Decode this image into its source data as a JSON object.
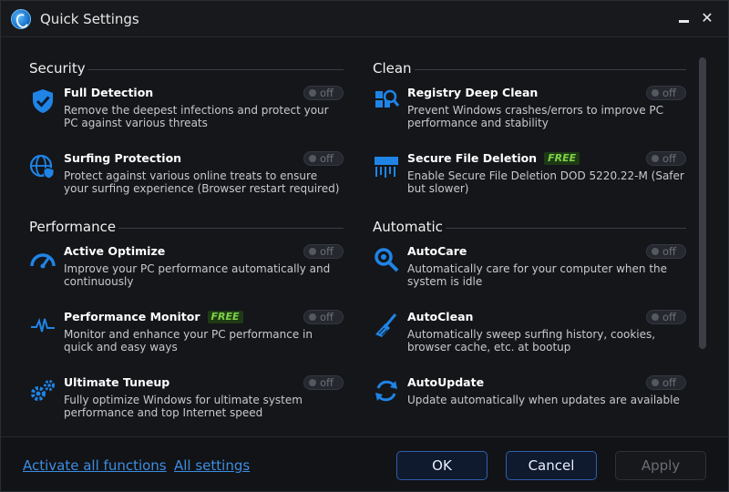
{
  "window": {
    "title": "Quick Settings",
    "close_glyph": "✕"
  },
  "sections": {
    "security": {
      "title": "Security",
      "items": [
        {
          "name": "Full Detection",
          "desc": "Remove the deepest infections and protect your PC against various threats",
          "toggle": "off",
          "icon": "shield-check-icon"
        },
        {
          "name": "Surfing Protection",
          "desc": "Protect against various online treats to ensure your surfing experience (Browser restart required)",
          "toggle": "off",
          "icon": "globe-shield-icon"
        }
      ]
    },
    "performance": {
      "title": "Performance",
      "items": [
        {
          "name": "Active Optimize",
          "desc": "Improve your PC performance automatically and continuously",
          "toggle": "off",
          "icon": "speedometer-icon"
        },
        {
          "name": "Performance Monitor",
          "badge": "FREE",
          "desc": "Monitor and enhance your PC performance in quick and easy ways",
          "toggle": "off",
          "icon": "heartbeat-icon"
        },
        {
          "name": "Ultimate Tuneup",
          "desc": "Fully optimize Windows for ultimate system performance and top Internet speed",
          "toggle": "off",
          "icon": "gears-icon"
        }
      ]
    },
    "clean": {
      "title": "Clean",
      "items": [
        {
          "name": "Registry Deep Clean",
          "desc": "Prevent Windows crashes/errors to improve PC performance and stability",
          "toggle": "off",
          "icon": "registry-search-icon"
        },
        {
          "name": "Secure File Deletion",
          "badge": "FREE",
          "desc": "Enable Secure File Deletion DOD 5220.22-M (Safer but slower)",
          "toggle": "off",
          "icon": "shredder-icon"
        }
      ]
    },
    "automatic": {
      "title": "Automatic",
      "items": [
        {
          "name": "AutoCare",
          "desc": "Automatically care for your computer when the system is idle",
          "toggle": "off",
          "icon": "magnifier-icon"
        },
        {
          "name": "AutoClean",
          "desc": "Automatically sweep surfing history, cookies, browser cache, etc. at bootup",
          "toggle": "off",
          "icon": "broom-icon"
        },
        {
          "name": "AutoUpdate",
          "desc": "Update automatically when updates are available",
          "toggle": "off",
          "icon": "refresh-icon"
        }
      ]
    }
  },
  "footer": {
    "activate_all": "Activate all functions",
    "all_settings": "All settings",
    "ok": "OK",
    "cancel": "Cancel",
    "apply": "Apply"
  },
  "colors": {
    "accent": "#2e8ae6",
    "link": "#3c8de0",
    "free_badge": "#7fd24a"
  }
}
